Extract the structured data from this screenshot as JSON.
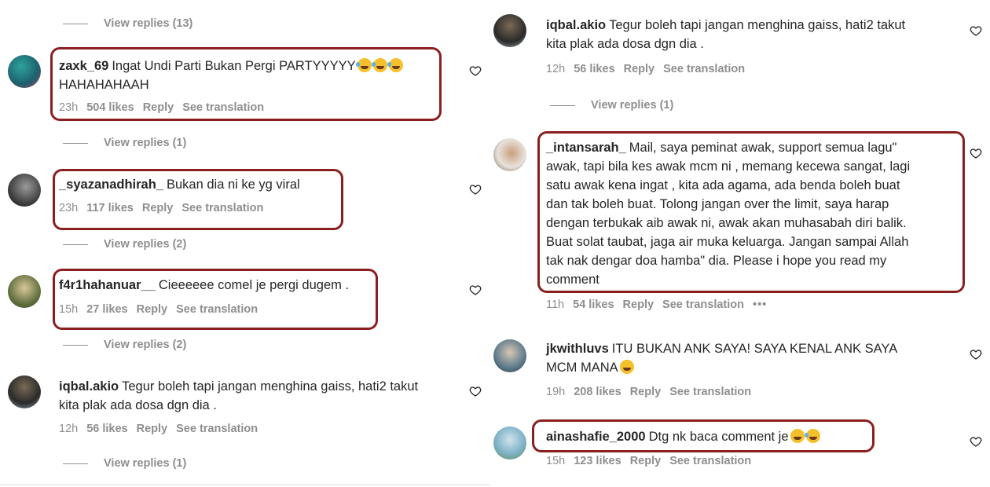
{
  "left": {
    "view_replies_top": "View replies (13)",
    "comments": [
      {
        "username": "zaxk_69",
        "text": "Ingat Undi Parti Bukan Pergi PARTYYYYY",
        "text_line2": "HAHAHAHAAH",
        "time": "23h",
        "likes": "504 likes",
        "reply": "Reply",
        "translate": "See translation",
        "view_replies": "View replies (1)"
      },
      {
        "username": "_syazanadhirah_",
        "text": "Bukan dia ni ke yg viral",
        "time": "23h",
        "likes": "117 likes",
        "reply": "Reply",
        "translate": "See translation",
        "view_replies": "View replies (2)"
      },
      {
        "username": "f4r1hahanuar__",
        "text": "Cieeeeee comel je pergi dugem .",
        "time": "15h",
        "likes": "27 likes",
        "reply": "Reply",
        "translate": "See translation",
        "view_replies": "View replies (2)"
      },
      {
        "username": "iqbal.akio",
        "text": "Tegur boleh tapi jangan menghina gaiss, hati2 takut",
        "text_line2": "kita plak ada dosa dgn dia .",
        "time": "12h",
        "likes": "56 likes",
        "reply": "Reply",
        "translate": "See translation",
        "view_replies": "View replies (1)"
      }
    ]
  },
  "right": {
    "comments": [
      {
        "username": "iqbal.akio",
        "text": "Tegur boleh tapi jangan menghina gaiss, hati2 takut",
        "text_line2": "kita plak ada dosa dgn dia .",
        "time": "12h",
        "likes": "56 likes",
        "reply": "Reply",
        "translate": "See translation",
        "view_replies": "View replies (1)"
      },
      {
        "username": "_intansarah_",
        "lines": [
          "Mail, saya peminat awak, support semua lagu\"",
          "awak, tapi bila kes awak mcm ni , memang kecewa sangat, lagi",
          "satu awak kena ingat , kita ada agama, ada benda boleh buat",
          "dan tak boleh buat. Tolong jangan over the limit, saya harap",
          "dengan terbukak aib awak ni, awak akan muhasabah diri balik.",
          "Buat solat taubat, jaga air muka keluarga. Jangan sampai Allah",
          "tak nak dengar doa hamba\" dia. Please i hope you read my",
          "comment"
        ],
        "time": "11h",
        "likes": "54 likes",
        "reply": "Reply",
        "translate": "See translation",
        "more": "•••"
      },
      {
        "username": "jkwithluvs",
        "text": "ITU BUKAN ANK SAYA! SAYA KENAL ANK SAYA",
        "text_line2": "MCM MANA",
        "time": "19h",
        "likes": "208 likes",
        "reply": "Reply",
        "translate": "See translation"
      },
      {
        "username": "ainashafie_2000",
        "text": "Dtg nk baca comment je",
        "time": "15h",
        "likes": "123 likes",
        "reply": "Reply",
        "translate": "See translation"
      }
    ]
  },
  "colors": {
    "highlight": "#8b1f1f",
    "meta": "#8e8e8e",
    "text": "#262626"
  },
  "icons": {
    "like": "heart-outline-icon",
    "emoji_laugh": "face-with-tears-of-joy",
    "emoji_wink": "zany-face"
  }
}
